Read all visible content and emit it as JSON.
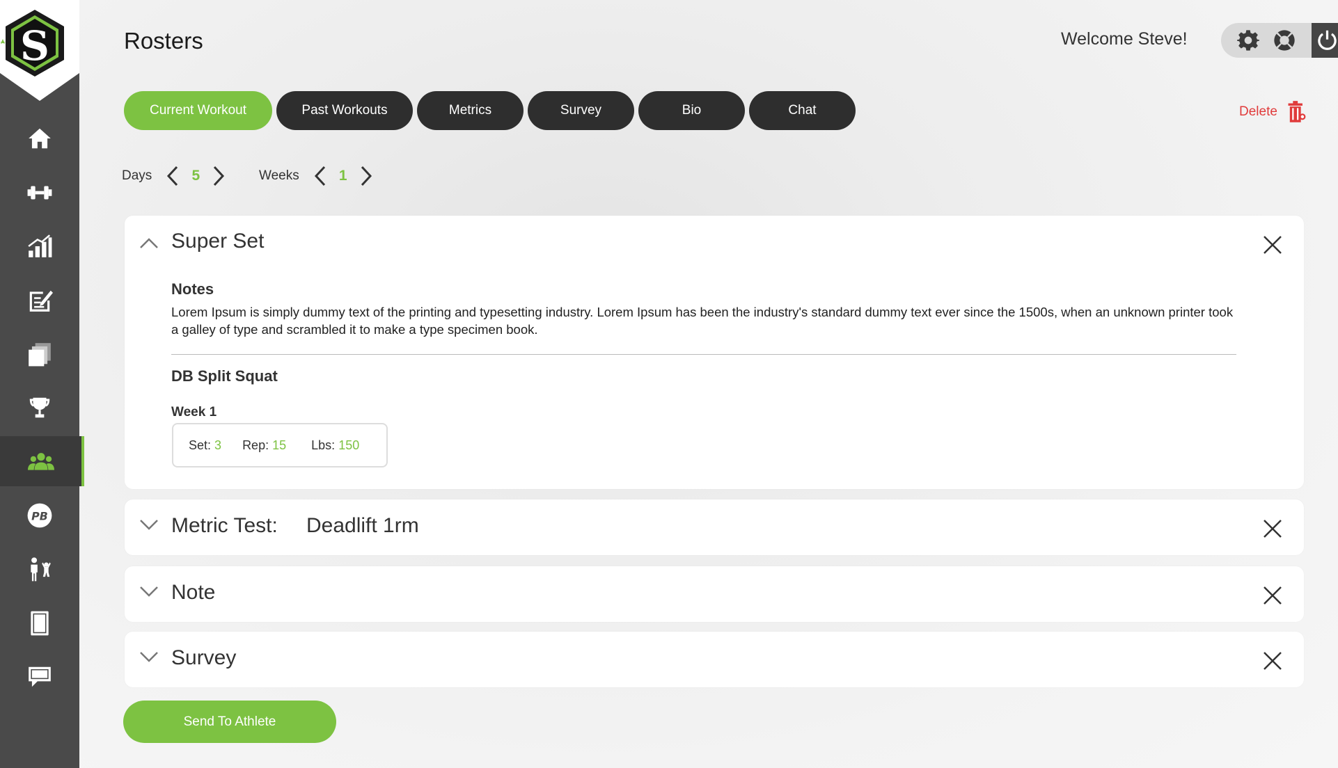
{
  "header": {
    "title": "Rosters",
    "welcome": "Welcome Steve!"
  },
  "nav": {
    "items": [
      {
        "icon": "home-icon"
      },
      {
        "icon": "dumbbell-icon"
      },
      {
        "icon": "bar-chart-icon"
      },
      {
        "icon": "edit-note-icon"
      },
      {
        "icon": "copy-icon"
      },
      {
        "icon": "trophy-icon"
      },
      {
        "icon": "team-icon",
        "active": true
      },
      {
        "icon": "pb-badge-icon"
      },
      {
        "icon": "coach-icon"
      },
      {
        "icon": "tablet-icon"
      },
      {
        "icon": "chat-icon"
      }
    ],
    "accent_color": "#7dc242"
  },
  "tabs": [
    {
      "label": "Current Workout",
      "active": true
    },
    {
      "label": "Past Workouts"
    },
    {
      "label": "Metrics"
    },
    {
      "label": "Survey"
    },
    {
      "label": "Bio"
    },
    {
      "label": "Chat"
    }
  ],
  "delete_label": "Delete",
  "pager": {
    "days_label": "Days",
    "days_value": "5",
    "weeks_label": "Weeks",
    "weeks_value": "1"
  },
  "super_set": {
    "title": "Super Set",
    "notes_heading": "Notes",
    "notes_text": "Lorem Ipsum is simply dummy text of the printing and typesetting industry. Lorem Ipsum has been the industry's standard dummy text ever since the 1500s, when an unknown printer took a galley of type and scrambled it to make a type specimen book.",
    "exercise": "DB Split Squat",
    "week_label": "Week 1",
    "set_label": "Set:",
    "set_value": "3",
    "rep_label": "Rep:",
    "rep_value": "15",
    "lbs_label": "Lbs:",
    "lbs_value": "150"
  },
  "metric_test": {
    "title": "Metric Test:",
    "value": "Deadlift 1rm"
  },
  "note_card": {
    "title": "Note"
  },
  "survey_card": {
    "title": "Survey"
  },
  "send_button": "Send To Athlete",
  "colors": {
    "accent": "#7dc242",
    "danger": "#e03b3b",
    "dark": "#2e2e2e"
  }
}
